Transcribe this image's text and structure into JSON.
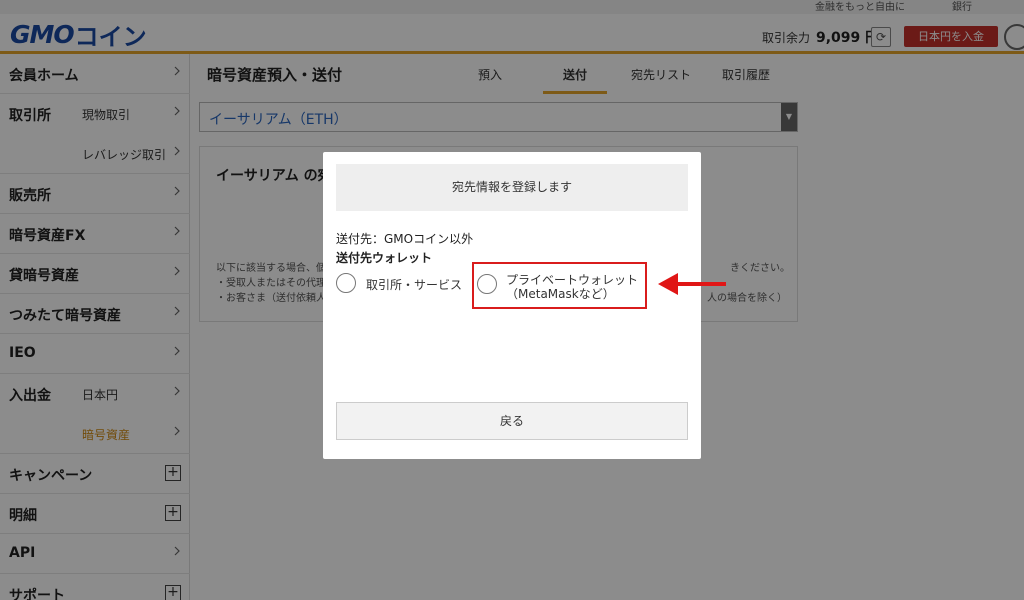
{
  "topbar": {
    "left_text": "金融をもっと自由に",
    "right_text": "銀行"
  },
  "header": {
    "logo_gmo": "GMO",
    "logo_coin": "コイン",
    "balance_label": "取引余力",
    "balance_value": "9,099 円",
    "refresh_icon": "refresh-icon",
    "deposit_label": "日本円を入金",
    "user_icon": "user-icon"
  },
  "sidebar": {
    "items": [
      {
        "label": "会員ホーム",
        "sub": ""
      },
      {
        "label": "取引所",
        "sub": "現物取引"
      },
      {
        "label": "",
        "sub": "レバレッジ取引"
      },
      {
        "label": "販売所",
        "sub": ""
      },
      {
        "label": "暗号資産FX",
        "sub": ""
      },
      {
        "label": "貸暗号資産",
        "sub": ""
      },
      {
        "label": "つみたて暗号資産",
        "sub": ""
      },
      {
        "label": "IEO",
        "sub": ""
      },
      {
        "label": "入出金",
        "sub": "日本円"
      },
      {
        "label": "",
        "sub": "暗号資産"
      },
      {
        "label": "キャンペーン",
        "sub": ""
      },
      {
        "label": "明細",
        "sub": ""
      },
      {
        "label": "API",
        "sub": ""
      },
      {
        "label": "サポート",
        "sub": ""
      }
    ]
  },
  "main": {
    "title": "暗号資産預入・送付",
    "tabs": [
      "預入",
      "送付",
      "宛先リスト",
      "取引履歴"
    ],
    "active_tab": "送付",
    "asset_selected": "イーサリアム（ETH）",
    "card_title": "イーサリアム の宛",
    "card_lines": [
      "以下に該当する場合、個",
      "・受取人またはその代理",
      "・お客さま（送付依頼人",
      "きください。",
      "人の場合を除く）"
    ]
  },
  "modal": {
    "header": "宛先情報を登録します",
    "destination_line": "送付先：GMOコイン以外",
    "wallet_title": "送付先ウォレット",
    "option_exchange": "取引所・サービス",
    "option_private_line1": "プライベートウォレット",
    "option_private_line2": "（MetaMaskなど）",
    "back_label": "戻る"
  },
  "colors": {
    "brand_blue": "#1a4aa3",
    "accent_orange": "#e3a52a",
    "deposit_red": "#c4312b",
    "highlight_red": "#d91c1c",
    "link_blue": "#2b66c0"
  }
}
